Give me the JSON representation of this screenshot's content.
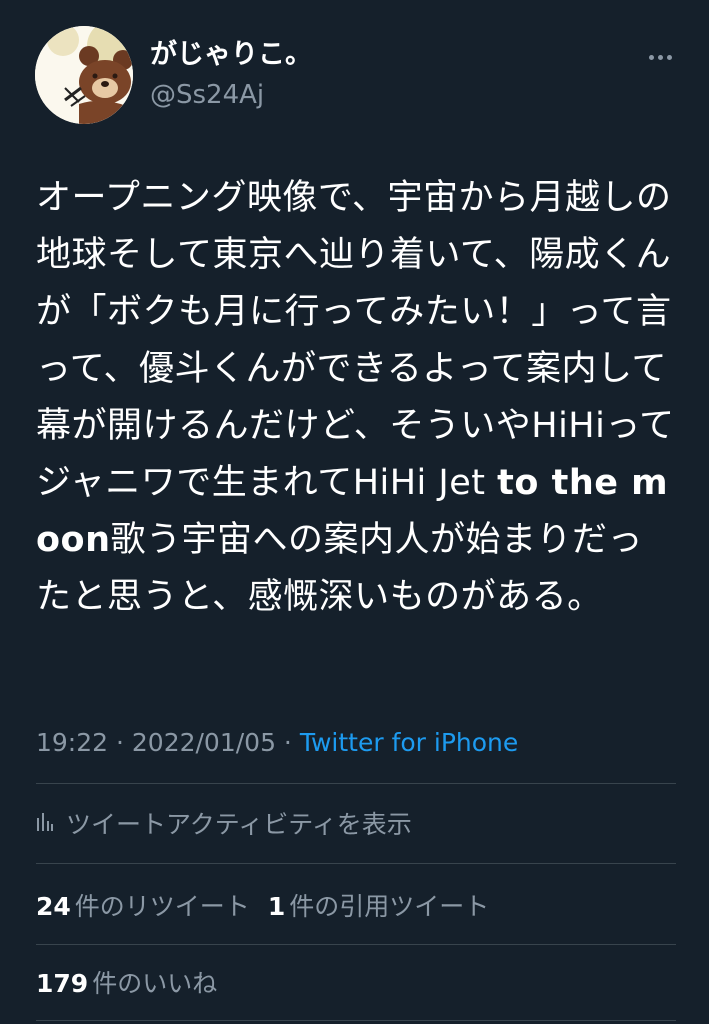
{
  "user": {
    "display_name": "がじゃりこ。",
    "handle": "@Ss24Aj"
  },
  "tweet": {
    "text_before_bold": "オープニング映像で、宇宙から月越しの地球そして東京へ辿り着いて、陽成くんが「ボクも月に行ってみたい！」って言って、優斗くんができるよって案内して幕が開けるんだけど、そういやHiHiってジャニワで生まれてHiHi Jet ",
    "text_bold": "to the moon",
    "text_after_bold": "歌う宇宙への案内人が始まりだったと思うと、感慨深いものがある。",
    "time": "19:22",
    "separator": " · ",
    "date": "2022/01/05",
    "source": "Twitter for iPhone"
  },
  "activity": {
    "label": "ツイートアクティビティを表示",
    "icon": "analytics-bars-icon"
  },
  "stats": {
    "retweets_count": "24",
    "retweets_label": "件のリツイート",
    "quotes_count": "1",
    "quotes_label": "件の引用ツイート",
    "likes_count": "179",
    "likes_label": "件のいいね"
  },
  "colors": {
    "background": "#15202b",
    "primary_text": "#ffffff",
    "secondary_text": "#8b98a5",
    "link": "#1d9bf0",
    "divider": "#38444d"
  }
}
